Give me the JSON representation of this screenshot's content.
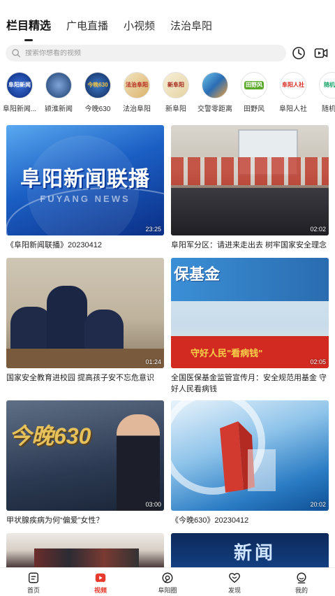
{
  "top_tabs": [
    "栏目精选",
    "广电直播",
    "小视频",
    "法治阜阳"
  ],
  "search": {
    "placeholder": "搜索你想看的视频"
  },
  "channels": [
    {
      "label": "阜阳新闻...",
      "logo": "阜阳新闻"
    },
    {
      "label": "颍淮新闻",
      "logo": ""
    },
    {
      "label": "今晚630",
      "logo": "今晚630"
    },
    {
      "label": "法治阜阳",
      "logo": "法治阜阳"
    },
    {
      "label": "新阜阳",
      "logo": "新阜阳"
    },
    {
      "label": "交警零距离",
      "logo": ""
    },
    {
      "label": "田野风",
      "logo": "田野风"
    },
    {
      "label": "阜阳人社",
      "logo": "阜阳人社"
    },
    {
      "label": "随机查",
      "logo": "随机查"
    }
  ],
  "videos": [
    {
      "title": "《阜阳新闻联播》20230412",
      "duration": "23:25",
      "overlay": "阜阳新闻联播",
      "overlay_sub": "FUYANG NEWS"
    },
    {
      "title": "阜阳军分区：请进来走出去 树牢国家安全理念",
      "duration": "02:02"
    },
    {
      "title": "国家安全教育进校园  提高孩子安不忘危意识",
      "duration": "01:24"
    },
    {
      "title": "全国医保基金监管宣传月：安全规范用基金  守好人民看病钱",
      "duration": "02:05",
      "overlay": "保基金",
      "overlay_sub": "守好人民\"看病钱\""
    },
    {
      "title": "甲状腺疾病为何“偏爱”女性？",
      "duration": "03:00",
      "overlay": "今晚630"
    },
    {
      "title": "《今晚630》20230412",
      "duration": "20:02"
    },
    {
      "title": "",
      "duration": ""
    },
    {
      "title": "",
      "duration": "",
      "overlay": "新闻"
    }
  ],
  "bottom_nav": [
    {
      "label": "首页",
      "icon": "home-icon"
    },
    {
      "label": "视频",
      "icon": "video-icon",
      "active": true
    },
    {
      "label": "阜阳圈",
      "icon": "circle-icon"
    },
    {
      "label": "发现",
      "icon": "discover-icon"
    },
    {
      "label": "我的",
      "icon": "profile-icon"
    }
  ],
  "colors": {
    "accent": "#e73a2c",
    "search_bg": "#f1f1f1"
  }
}
